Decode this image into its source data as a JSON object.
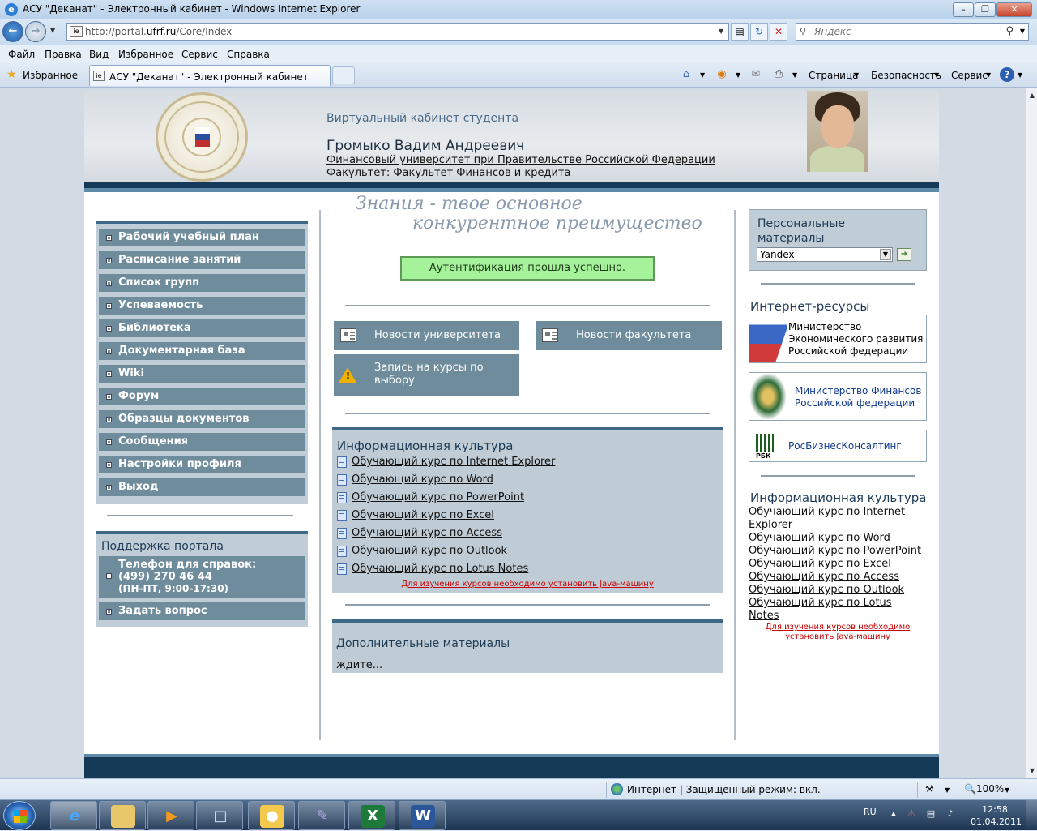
{
  "window": {
    "title": "АСУ \"Деканат\" - Электронный кабинет - Windows Internet Explorer"
  },
  "address_bar": {
    "url_prefix": "http://portal.",
    "url_domain": "ufrf.ru",
    "url_path": "/Core/Index"
  },
  "search": {
    "placeholder": "Яндекс"
  },
  "menu": [
    "Файл",
    "Правка",
    "Вид",
    "Избранное",
    "Сервис",
    "Справка"
  ],
  "favorites_bar": {
    "favorites_label": "Избранное",
    "tab_title": "АСУ \"Деканат\" - Электронный кабинет"
  },
  "command_bar": {
    "page": "Страница",
    "safety": "Безопасность",
    "tools": "Сервис"
  },
  "header": {
    "cabinet": "Виртуальный кабинет студента",
    "student_name": "Громыко Вадим Андреевич",
    "university": "Финансовый университет при Правительстве Российской Федерации",
    "faculty": "Факультет: Факультет Финансов и кредита"
  },
  "slogan": {
    "line1": "Знания - твое основное",
    "line2": "конкурентное преимущество"
  },
  "nav": [
    "Рабочий учебный план",
    "Расписание занятий",
    "Список групп",
    "Успеваемость",
    "Библиотека",
    "Документарная база",
    "Wiki",
    "Форум",
    "Образцы документов",
    "Сообщения",
    "Настройки профиля",
    "Выход"
  ],
  "support": {
    "title": "Поддержка портала",
    "phone_label": "Телефон для справок:",
    "phone": "(499) 270 46 44",
    "hours": "(ПН-ПТ, 9:00-17:30)",
    "ask": "Задать вопрос"
  },
  "auth_message": "Аутентификация прошла успешно.",
  "tiles": {
    "univ_news": "Новости университета",
    "faculty_news": "Новости факультета",
    "courses_line1": "Запись на курсы по",
    "courses_line2": "выбору"
  },
  "info_culture": {
    "title": "Информационная культура",
    "courses": [
      "Обучающий курс по Internet Explorer",
      "Обучающий курс по Word",
      "Обучающий курс по PowerPoint",
      "Обучающий курс по Excel",
      "Обучающий курс по Access",
      "Обучающий курс по Outlook",
      "Обучающий курс по Lotus Notes"
    ],
    "java_note": "Для изучения курсов необходимо установить Java-машину"
  },
  "additional": {
    "title": "Дополнительные материалы",
    "status": "ждите..."
  },
  "right": {
    "personal_line1": "Персональные",
    "personal_line2": "материалы",
    "personal_selected": "Yandex",
    "internet_title": "Интернет-ресурсы",
    "resources": [
      {
        "line1": "Министерство",
        "line2": "Экономического развития",
        "line3": "Российской федерации"
      },
      {
        "line1": "Министерство Финансов",
        "line2": "Российской федерации"
      },
      {
        "line1": "РосБизнесКонсалтинг"
      }
    ],
    "rbk_logo": "РБК",
    "culture_title": "Информационная культура",
    "culture_courses": [
      "Обучающий курс по Internet",
      "Explorer",
      "Обучающий курс по Word",
      "Обучающий курс по PowerPoint",
      "Обучающий курс по Excel",
      "Обучающий курс по Access",
      "Обучающий курс по Outlook",
      "Обучающий курс по Lotus",
      "Notes"
    ],
    "java_line1": "Для изучения курсов необходимо",
    "java_line2": "установить Java-машину"
  },
  "status_bar": {
    "zone": "Интернет | Защищенный режим: вкл.",
    "zoom": "100%"
  },
  "taskbar": {
    "lang": "RU",
    "time": "12:58",
    "date": "01.04.2011"
  }
}
